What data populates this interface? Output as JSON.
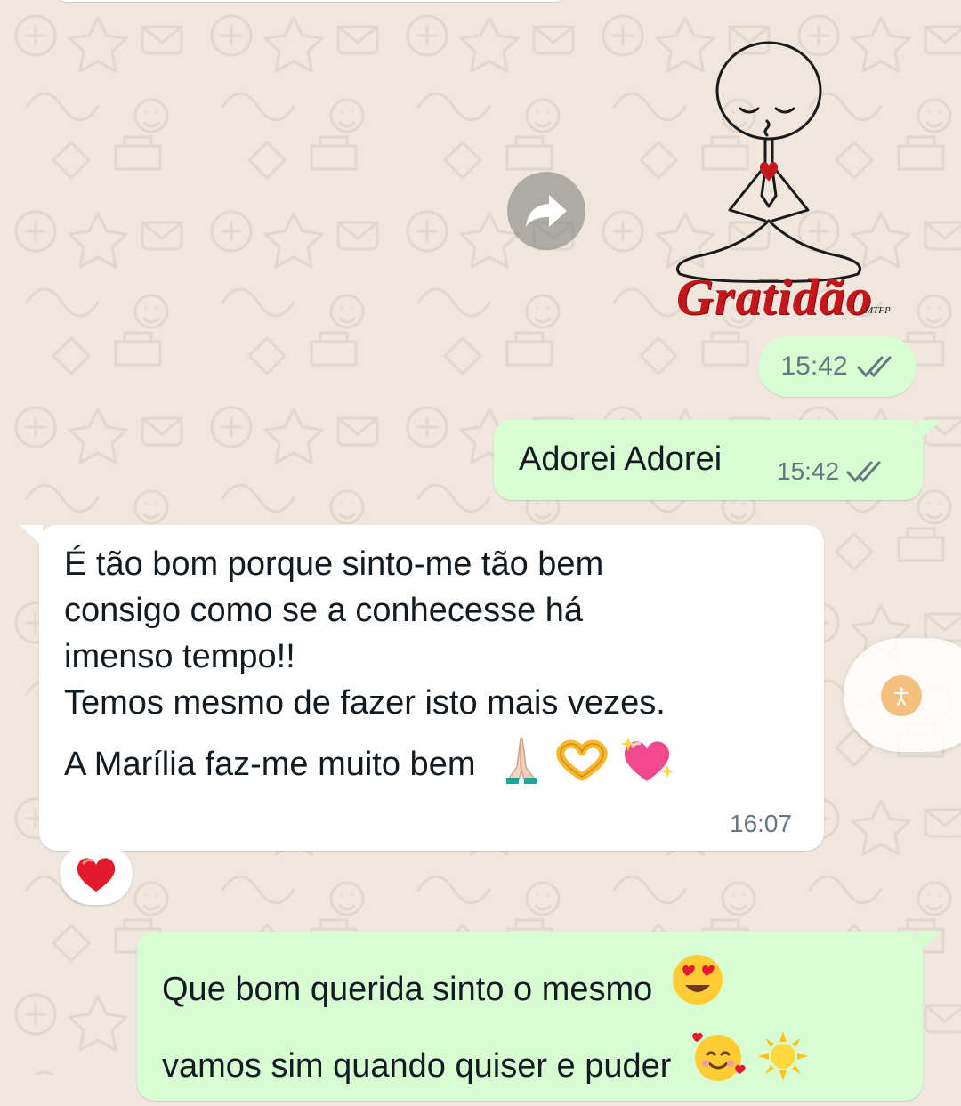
{
  "theme": {
    "wallpaper_color": "#efe7de",
    "outgoing_bubble_color": "#d9fdd3",
    "incoming_bubble_color": "#ffffff",
    "time_color": "#667781",
    "read_tick_color": "#53bdeb"
  },
  "sticker": {
    "text": "Gratidão",
    "signature": "MTFP",
    "icon": "meditation-figure"
  },
  "messages": [
    {
      "id": "sticker_time",
      "direction": "outgoing",
      "time": "15:42",
      "status": "read"
    },
    {
      "id": "adorei",
      "direction": "outgoing",
      "text": "Adorei Adorei",
      "time": "15:42",
      "status": "read"
    },
    {
      "id": "incoming_long",
      "direction": "incoming",
      "lines": [
        "É tão bom porque sinto-me tão bem",
        "consigo como se a conhecesse há",
        "imenso tempo!!",
        "Temos mesmo de fazer isto mais vezes.",
        "A Marília faz-me muito bem"
      ],
      "emojis": [
        "🙏",
        "🫶",
        "💖"
      ],
      "time": "16:07",
      "reaction": "❤️"
    },
    {
      "id": "outgoing_last",
      "direction": "outgoing",
      "lines": [
        "Que bom querida sinto o mesmo",
        "vamos sim quando quiser e puder"
      ],
      "emojis_line1": [
        "😍"
      ],
      "emojis_line2": [
        "🥰",
        "☀️"
      ]
    }
  ],
  "icons": {
    "forward": "forward-arrow-icon",
    "read_ticks": "double-check-icon",
    "accessibility": "accessibility-icon"
  }
}
